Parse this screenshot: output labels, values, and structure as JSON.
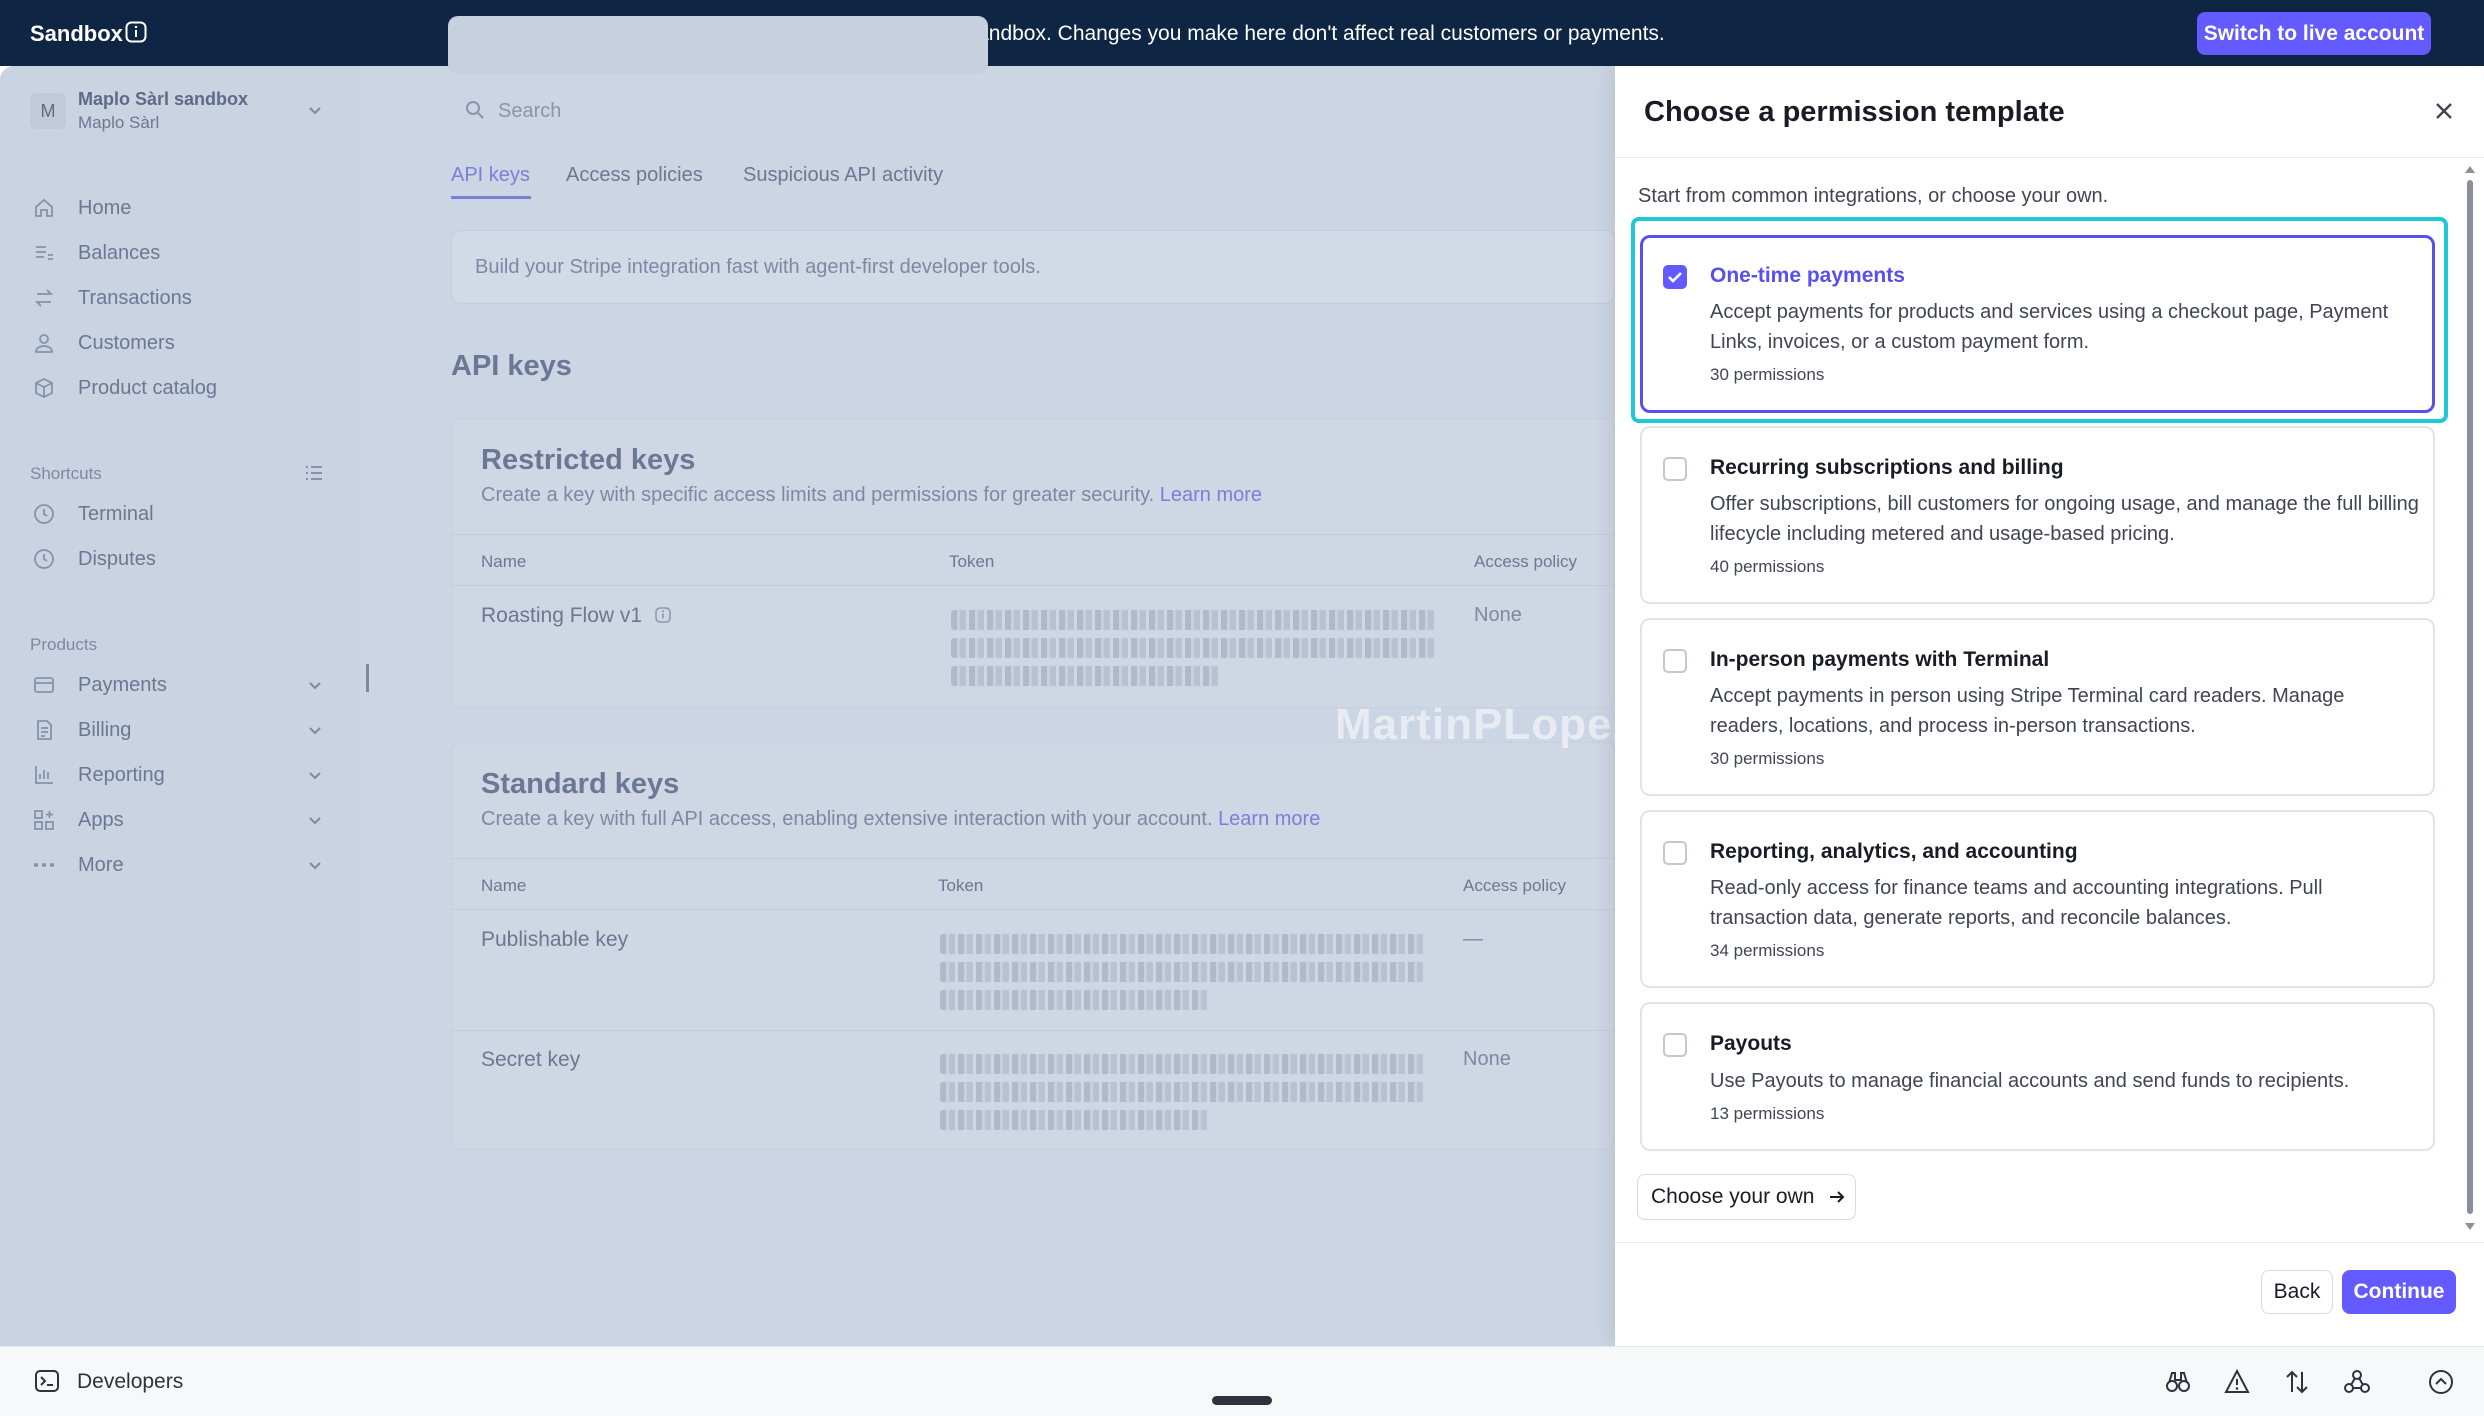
{
  "banner": {
    "title": "Sandbox",
    "message": "You're testing in a sandbox. Changes you make here don't affect real customers or payments.",
    "live_button": "Switch to live account"
  },
  "account": {
    "initial": "M",
    "name": "Maplo Sàrl sandbox",
    "sub": "Maplo Sàrl"
  },
  "sidebar": {
    "items": [
      {
        "label": "Home",
        "icon": "home-icon"
      },
      {
        "label": "Balances",
        "icon": "balances-icon"
      },
      {
        "label": "Transactions",
        "icon": "transactions-icon"
      },
      {
        "label": "Customers",
        "icon": "customers-icon"
      },
      {
        "label": "Product catalog",
        "icon": "product-catalog-icon"
      }
    ],
    "shortcuts_label": "Shortcuts",
    "shortcuts": [
      {
        "label": "Terminal",
        "icon": "clock-icon"
      },
      {
        "label": "Disputes",
        "icon": "clock-icon"
      }
    ],
    "products_label": "Products",
    "products": [
      {
        "label": "Payments",
        "icon": "payments-icon"
      },
      {
        "label": "Billing",
        "icon": "billing-icon"
      },
      {
        "label": "Reporting",
        "icon": "reporting-icon"
      },
      {
        "label": "Apps",
        "icon": "apps-icon"
      },
      {
        "label": "More",
        "icon": "more-icon"
      }
    ]
  },
  "search": {
    "placeholder": "Search"
  },
  "tabs": [
    "API keys",
    "Access policies",
    "Suspicious API activity"
  ],
  "notice": "Build your Stripe integration fast with agent-first developer tools.",
  "api_keys_heading": "API keys",
  "restricted": {
    "title": "Restricted keys",
    "desc": "Create a key with specific access limits and permissions for greater security.",
    "learn_more": "Learn more",
    "columns": [
      "Name",
      "Token",
      "Access policy"
    ],
    "rows": [
      {
        "name": "Roasting Flow v1",
        "policy": "None"
      }
    ]
  },
  "standard": {
    "title": "Standard keys",
    "desc": "Create a key with full API access, enabling extensive interaction with your account.",
    "learn_more": "Learn more",
    "columns": [
      "Name",
      "Token",
      "Access policy"
    ],
    "rows": [
      {
        "name": "Publishable key",
        "policy": "—"
      },
      {
        "name": "Secret key",
        "policy": "None"
      }
    ]
  },
  "watermark": "MartinPLopez",
  "bottom": {
    "developers": "Developers"
  },
  "drawer": {
    "title": "Choose a permission template",
    "intro": "Start from common integrations, or choose your own.",
    "options": [
      {
        "title": "One-time payments",
        "desc": "Accept payments for products and services using a checkout page, Payment Links, invoices, or a custom payment form.",
        "count": "30 permissions",
        "checked": true
      },
      {
        "title": "Recurring subscriptions and billing",
        "desc": "Offer subscriptions, bill customers for ongoing usage, and manage the full billing lifecycle including metered and usage-based pricing.",
        "count": "40 permissions",
        "checked": false
      },
      {
        "title": "In-person payments with Terminal",
        "desc": "Accept payments in person using Stripe Terminal card readers. Manage readers, locations, and process in-person transactions.",
        "count": "30 permissions",
        "checked": false
      },
      {
        "title": "Reporting, analytics, and accounting",
        "desc": "Read-only access for finance teams and accounting integrations. Pull transaction data, generate reports, and reconcile balances.",
        "count": "34 permissions",
        "checked": false
      },
      {
        "title": "Payouts",
        "desc": "Use Payouts to manage financial accounts and send funds to recipients.",
        "count": "13 permissions",
        "checked": false
      }
    ],
    "choose_own": "Choose your own",
    "back": "Back",
    "continue": "Continue"
  },
  "colors": {
    "accent": "#635bff",
    "banner_bg": "#0e2544",
    "focus_ring": "#1ec8d8"
  }
}
